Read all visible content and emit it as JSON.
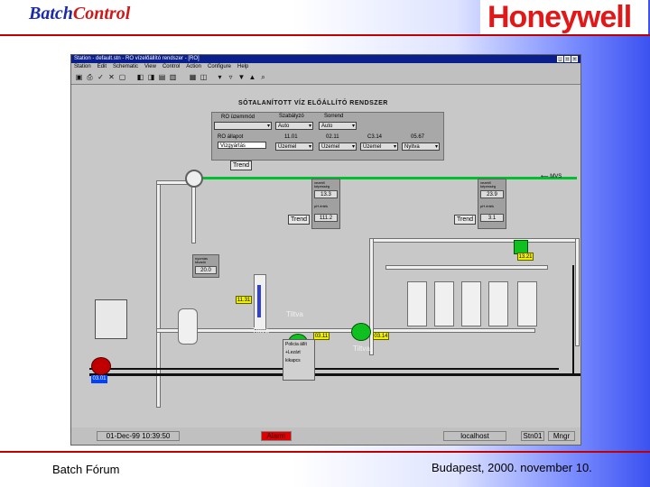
{
  "slide": {
    "title_batch": "Batch",
    "title_control": "Control",
    "logo": "Honeywell",
    "footer_left": "Batch Fórum",
    "footer_right": "Budapest, 2000. november 10."
  },
  "window": {
    "title": "Station - default.stn - RO vízelőállító rendszer - [RO]",
    "menu": [
      "Station",
      "Edit",
      "Schematic",
      "View",
      "Control",
      "Action",
      "Configure",
      "Help"
    ]
  },
  "toolbar_icons": [
    "station-icon",
    "print-icon",
    "acknowledge-icon",
    "silence-icon",
    "page-icon",
    "page-back-icon",
    "page-forward-icon",
    "detail-icon",
    "group-icon",
    "trend-icon",
    "alarm-icon",
    "message-icon",
    "point-icon",
    "down-icon",
    "up-icon",
    "search-icon"
  ],
  "schematic": {
    "heading": "SÓTALANÍTOTT VÍZ ELŐÁLLÍTÓ RENDSZER",
    "panel": {
      "row1_label": "RO üzemmód",
      "row1_value": "",
      "col_szabalyzo": "Szabályzó",
      "col_szabalyzo_value": "Auto",
      "col_sorrend": "Sorrend",
      "col_sorrend_value": "Auto",
      "row2_label": "RO állapot",
      "row2_value": "Vizgyártás",
      "trend_label": "Trend",
      "cells": [
        {
          "value": "11.01",
          "state": "Üzemel"
        },
        {
          "value": "02.11",
          "state": "Üzemel"
        },
        {
          "value": "C3.14",
          "state": "Üzemel"
        },
        {
          "value": "05.67",
          "state": "Nyitva"
        }
      ]
    },
    "tags": [
      {
        "caption": "vezető képesség",
        "value": "13.3"
      },
      {
        "caption": "pH érték",
        "value": "111.2"
      },
      {
        "caption": "vezető képesség",
        "value": "23.9"
      },
      {
        "caption": "pH érték",
        "value": "3.1"
      },
      {
        "caption": "nyomás távadó",
        "value": "20.0"
      }
    ],
    "trend_buttons": [
      "Trend",
      "Trend"
    ],
    "mv_label": "MVS",
    "yellow_labels": [
      "11.31",
      "03.11",
      "03.14",
      "13.21"
    ],
    "blue_label": "03.01",
    "tiltva": [
      "Tiltva",
      "Tiltva",
      "Tiltva"
    ],
    "popup_lines": [
      "Policia állít",
      "+Lezárt",
      "kikapcs"
    ]
  },
  "status_bar": {
    "datetime": "01-Dec-99 10:39:50",
    "alarm": "Alarm",
    "host": "localhost",
    "station": "Stn01",
    "level": "Mngr"
  }
}
